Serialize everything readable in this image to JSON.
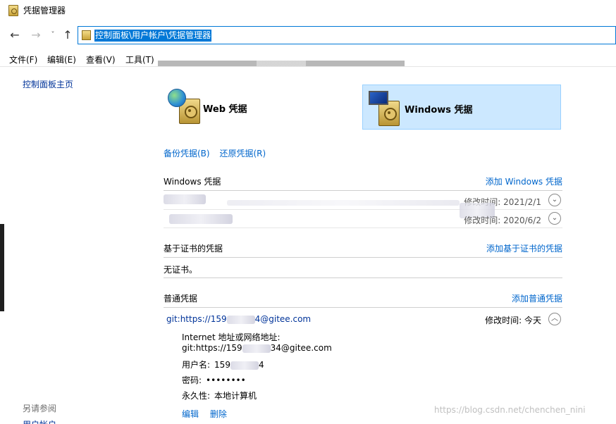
{
  "window": {
    "title": "凭据管理器"
  },
  "nav": {
    "back_glyph": "←",
    "forward_glyph": "→",
    "dropdown_glyph": "˅",
    "up_glyph": "↑",
    "address": "控制面板\\用户帐户\\凭据管理器"
  },
  "menu": [
    {
      "label": "文件(F)"
    },
    {
      "label": "编辑(E)"
    },
    {
      "label": "查看(V)"
    },
    {
      "label": "工具(T)"
    }
  ],
  "sidebar": {
    "home_link": "控制面板主页",
    "see_also": "另请参阅",
    "user_accounts": "用户帐户"
  },
  "tiles": {
    "web": "Web 凭据",
    "windows": "Windows 凭据"
  },
  "actions": {
    "backup": "备份凭据(B)",
    "restore": "还原凭据(R)"
  },
  "windows_section": {
    "title": "Windows 凭据",
    "add": "添加 Windows 凭据",
    "rows": [
      {
        "modified": "修改时间: 2021/2/1"
      },
      {
        "modified": "修改时间: 2020/6/2"
      }
    ]
  },
  "cert_section": {
    "title": "基于证书的凭据",
    "add": "添加基于证书的凭据",
    "empty": "无证书。"
  },
  "generic_section": {
    "title": "普通凭据",
    "add": "添加普通凭据",
    "entry": {
      "address": "git:https://159",
      "address_tail": "4@gitee.com",
      "modified_label": "修改时间:",
      "modified_value": "今天",
      "internet_label": "Internet 地址或网络地址:",
      "internet_value": "git:https://159",
      "internet_value_tail": "34@gitee.com",
      "username_label": "用户名:",
      "username_value": "159",
      "username_tail": "4",
      "password_label": "密码:",
      "password_value": "••••••••",
      "persistence_label": "永久性:",
      "persistence_value": "本地计算机",
      "edit": "编辑",
      "delete": "删除"
    }
  },
  "watermark": "https://blog.csdn.net/chenchen_nini",
  "colors": {
    "link": "#0066cc",
    "selection": "#0078d7",
    "tile_selected": "#cce8ff"
  }
}
